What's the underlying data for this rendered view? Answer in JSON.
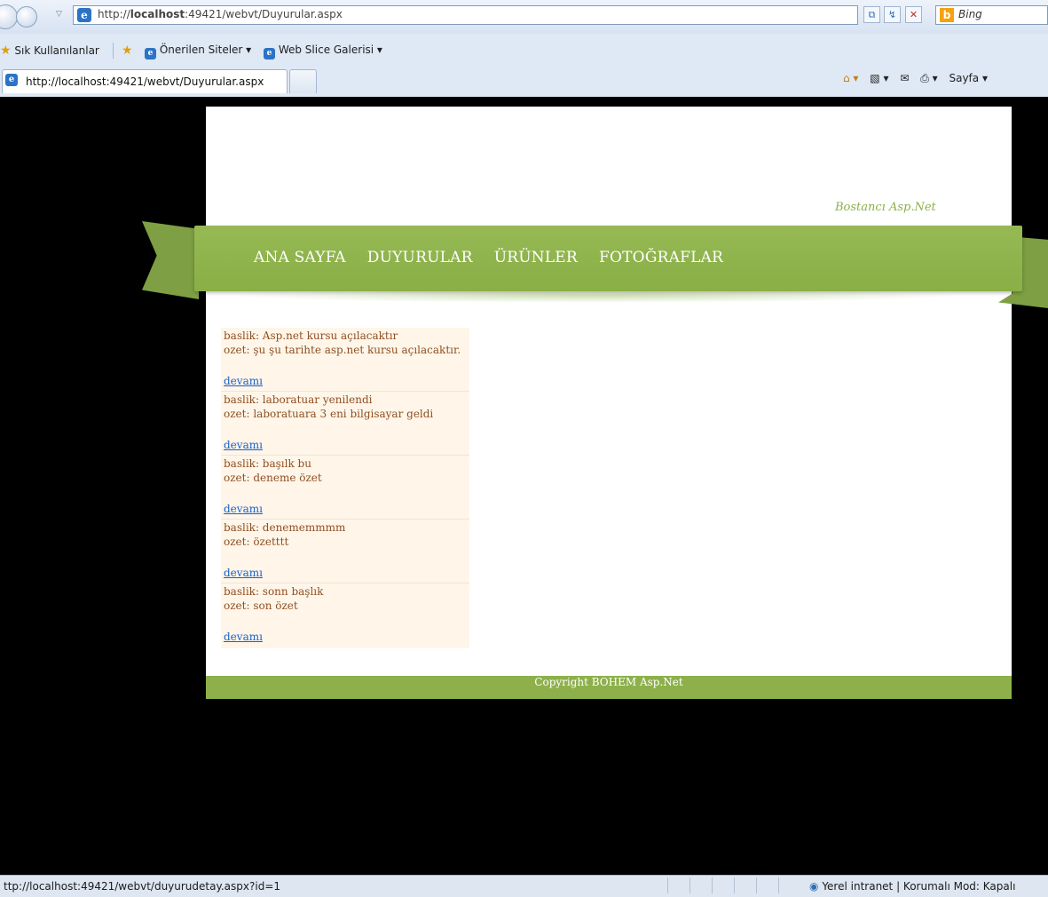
{
  "browser": {
    "url": "http://localhost:49421/webvt/Duyurular.aspx",
    "url_host_bold": "localhost",
    "url_prefix": "http://",
    "url_rest": ":49421/webvt/Duyurular.aspx",
    "search_placeholder": "Bing",
    "favorites_label": "Sık Kullanılanlar",
    "suggested_sites_label": "Önerilen Siteler ▾",
    "web_slice_label": "Web Slice Galerisi ▾",
    "tab_title": "http://localhost:49421/webvt/Duyurular.aspx",
    "page_menu_label": "Sayfa ▾",
    "status_url": "ttp://localhost:49421/webvt/duyurudetay.aspx?id=1",
    "zone_text": "Yerel intranet | Korumalı Mod: Kapalı"
  },
  "site": {
    "title": "Bostancı Asp.Net",
    "menu": [
      "ANA SAYFA",
      "DUYURULAR",
      "ÜRÜNLER",
      "FOTOĞRAFLAR"
    ],
    "footer": "Copyright BOHEM Asp.Net"
  },
  "announcements": [
    {
      "baslik": "baslik: Asp.net kursu açılacaktır",
      "ozet": "ozet: şu şu tarihte asp.net kursu açılacaktır.",
      "link": "devamı"
    },
    {
      "baslik": "baslik: laboratuar yenilendi",
      "ozet": "ozet: laboratuara 3 eni bilgisayar geldi",
      "link": "devamı"
    },
    {
      "baslik": "baslik: başılk bu",
      "ozet": "ozet: deneme özet",
      "link": "devamı"
    },
    {
      "baslik": "baslik: denememmmm",
      "ozet": "ozet: özetttt",
      "link": "devamı"
    },
    {
      "baslik": "baslik: sonn başlık",
      "ozet": "ozet: son özet",
      "link": "devamı"
    }
  ],
  "colors": {
    "accent_green": "#8db04a",
    "news_bg": "#fff6e9",
    "news_text": "#8f4f22",
    "link": "#1a5fcc"
  },
  "icons": [
    "back-icon",
    "forward-icon",
    "ie-icon",
    "compat-icon",
    "refresh-icon",
    "stop-icon",
    "bing-icon",
    "favorites-star-icon",
    "add-favorite-icon",
    "home-icon",
    "feeds-icon",
    "mail-icon",
    "print-icon",
    "globe-icon"
  ]
}
